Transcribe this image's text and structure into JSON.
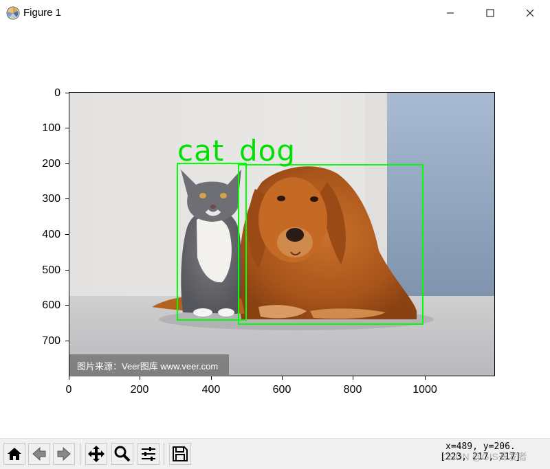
{
  "window": {
    "title": "Figure 1"
  },
  "axes": {
    "yticks": [
      "0",
      "100",
      "200",
      "300",
      "400",
      "500",
      "600",
      "700"
    ],
    "xticks": [
      "0",
      "200",
      "400",
      "600",
      "800",
      "1000"
    ]
  },
  "image": {
    "labels": {
      "cat": "cat",
      "dog": "dog"
    },
    "box_color": "#00ff00",
    "watermark": "图片来源：Veer图库 www.veer.com"
  },
  "toolbar": {
    "coords_line1": "x=489, y=206.",
    "coords_line2": "[223, 217, 217]",
    "watermark": "CSDN @GIS开发者"
  }
}
